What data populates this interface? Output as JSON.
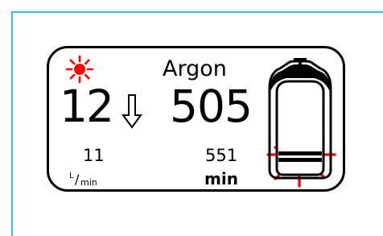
{
  "display": {
    "gas_name": "Argon",
    "flow": {
      "current": "12",
      "setting": "11",
      "unit_numerator": "L",
      "unit_slash": "/",
      "unit_denominator": "min"
    },
    "time": {
      "current": "505",
      "setting": "551",
      "unit": "min"
    }
  },
  "icons": {
    "sun": "sun-icon",
    "arrow": "down-arrow-icon",
    "bottle": "gas-bottle-icon",
    "burst": "red-burst-icon"
  },
  "colors": {
    "frame": "#3fbde8",
    "alert_red": "#ff0000",
    "border": "#000000"
  }
}
